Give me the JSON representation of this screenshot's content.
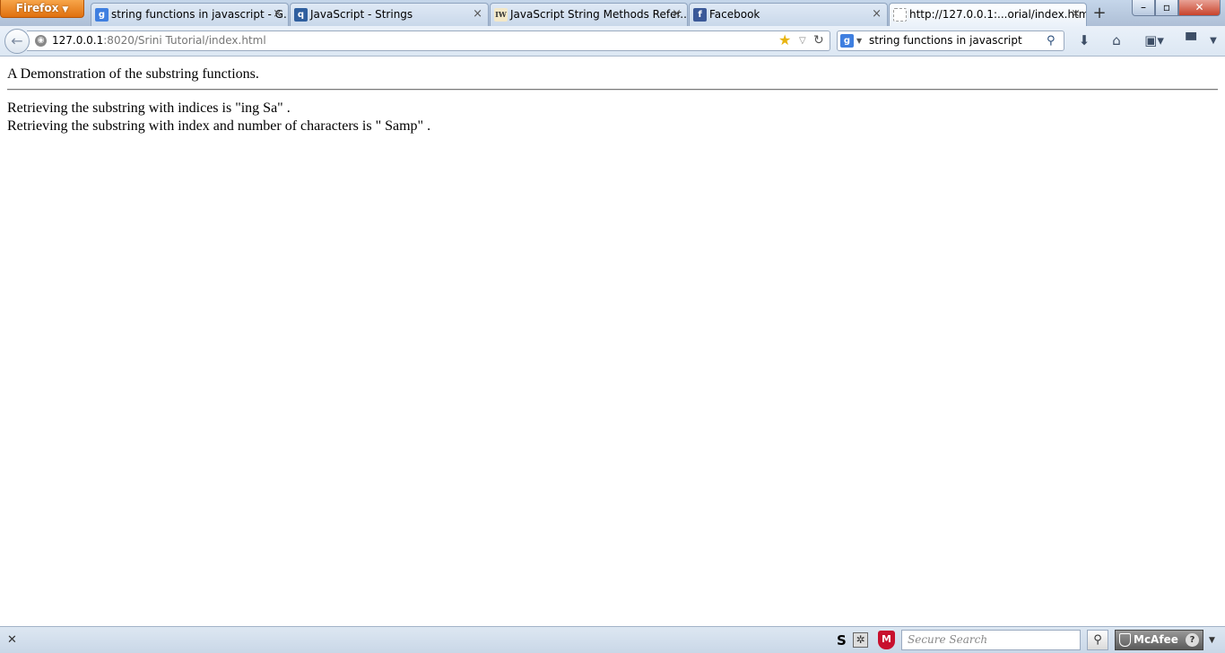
{
  "browser": {
    "menu_button_label": "Firefox",
    "tabs": [
      {
        "title": "string functions in javascript - G...",
        "favicon": "google-icon",
        "active": false
      },
      {
        "title": "JavaScript - Strings",
        "favicon": "tutorialspoint-icon",
        "active": false
      },
      {
        "title": "JavaScript String Methods Refer...",
        "favicon": "iw-icon",
        "active": false
      },
      {
        "title": "Facebook",
        "favicon": "facebook-icon",
        "active": false
      },
      {
        "title": "http://127.0.0.1:...orial/index.html",
        "favicon": "blank-page-icon",
        "active": true
      }
    ],
    "favicon_labels": {
      "google": "g",
      "tutorialspoint": "q",
      "iw": "IW",
      "facebook": "f"
    }
  },
  "navbar": {
    "url_host": "127.0.0.1",
    "url_rest": ":8020/Srini Tutorial/index.html",
    "search_value": "string functions in javascript"
  },
  "page": {
    "heading": "A Demonstration of the substring functions.",
    "line1": "Retrieving the substring with indices is \"ing Sa\" .",
    "line2": "Retrieving the substring with index and number of characters is \" Samp\" ."
  },
  "addon_bar": {
    "s_label": "S",
    "secure_search_placeholder": "Secure Search",
    "mcafee_label": "McAfee",
    "help_label": "?"
  },
  "colors": {
    "firefox_orange": "#e0700e",
    "tab_bar": "#c5d6ea",
    "close_red": "#c8432b",
    "mcafee_red": "#c8102e"
  }
}
